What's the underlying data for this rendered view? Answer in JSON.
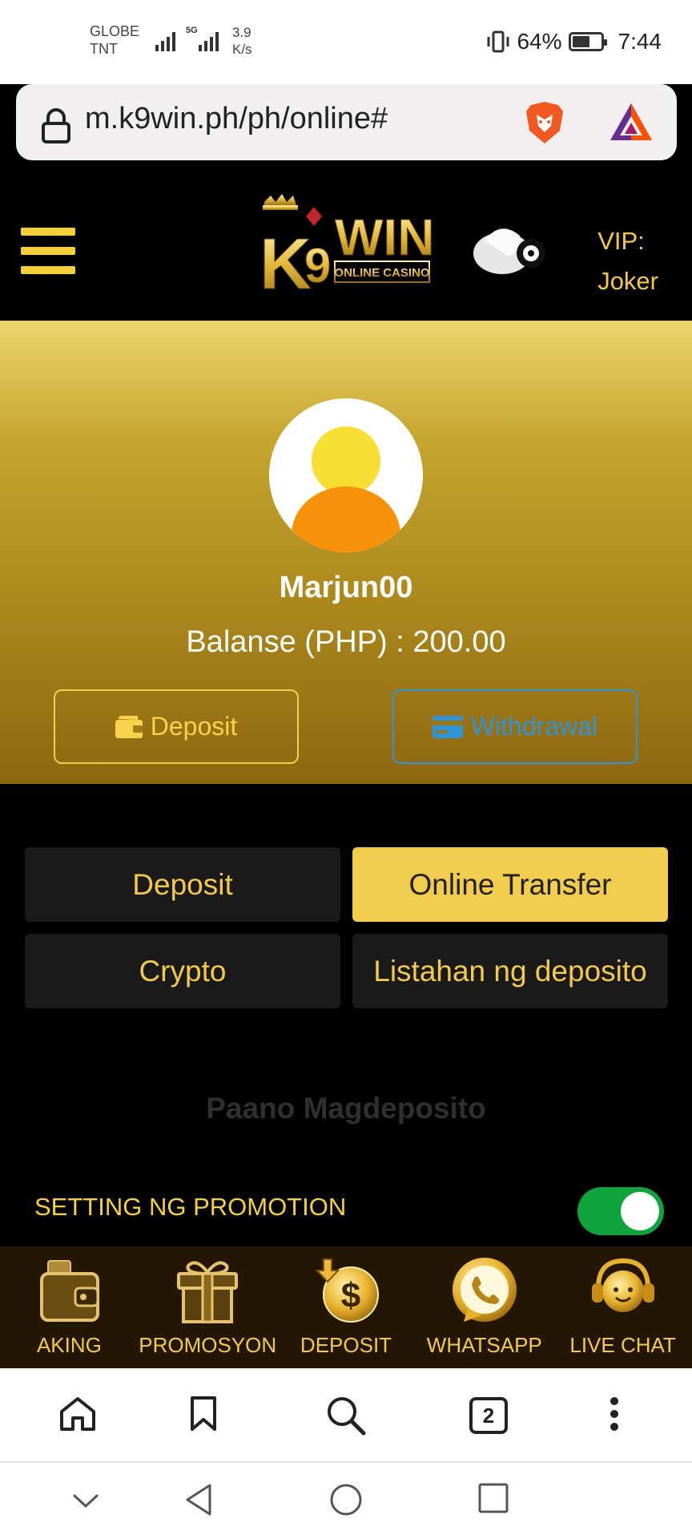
{
  "status_bar": {
    "carrier_1": "GLOBE",
    "carrier_2": "TNT",
    "network": "5G",
    "speed_value": "3.9",
    "speed_unit": "K/s",
    "battery": "64%",
    "battery_level": 0.64,
    "time": "7:44"
  },
  "browser": {
    "url": "m.k9win.ph/ph/online#",
    "tab_count": "2"
  },
  "header": {
    "logo_text": "K9WIN",
    "logo_subtext": "ONLINE CASINO",
    "vip_label": "VIP:",
    "vip_level": "Joker"
  },
  "profile": {
    "username": "Marjun00",
    "balance": "Balanse (PHP) : 200.00",
    "deposit_button": "Deposit",
    "withdrawal_button": "Withdrawal"
  },
  "tabs": [
    {
      "label": "Deposit",
      "active": false
    },
    {
      "label": "Online Transfer",
      "active": true
    },
    {
      "label": "Crypto",
      "active": false
    },
    {
      "label": "Listahan ng deposito",
      "active": false
    }
  ],
  "how_to": "Paano Magdeposito",
  "promotion": {
    "label": "SETTING NG PROMOTION",
    "enabled": true
  },
  "bottom_nav": [
    {
      "label": "AKING",
      "icon": "wallet-icon"
    },
    {
      "label": "PROMOSYON",
      "icon": "gift-icon"
    },
    {
      "label": "DEPOSIT",
      "icon": "deposit-coin-icon"
    },
    {
      "label": "WHATSAPP",
      "icon": "whatsapp-icon"
    },
    {
      "label": "LIVE CHAT",
      "icon": "live-chat-icon"
    }
  ],
  "colors": {
    "accent": "#f2cc4d",
    "withdrawal": "#2f94d8",
    "toggle_on": "#0fa33c",
    "background": "#000000"
  }
}
